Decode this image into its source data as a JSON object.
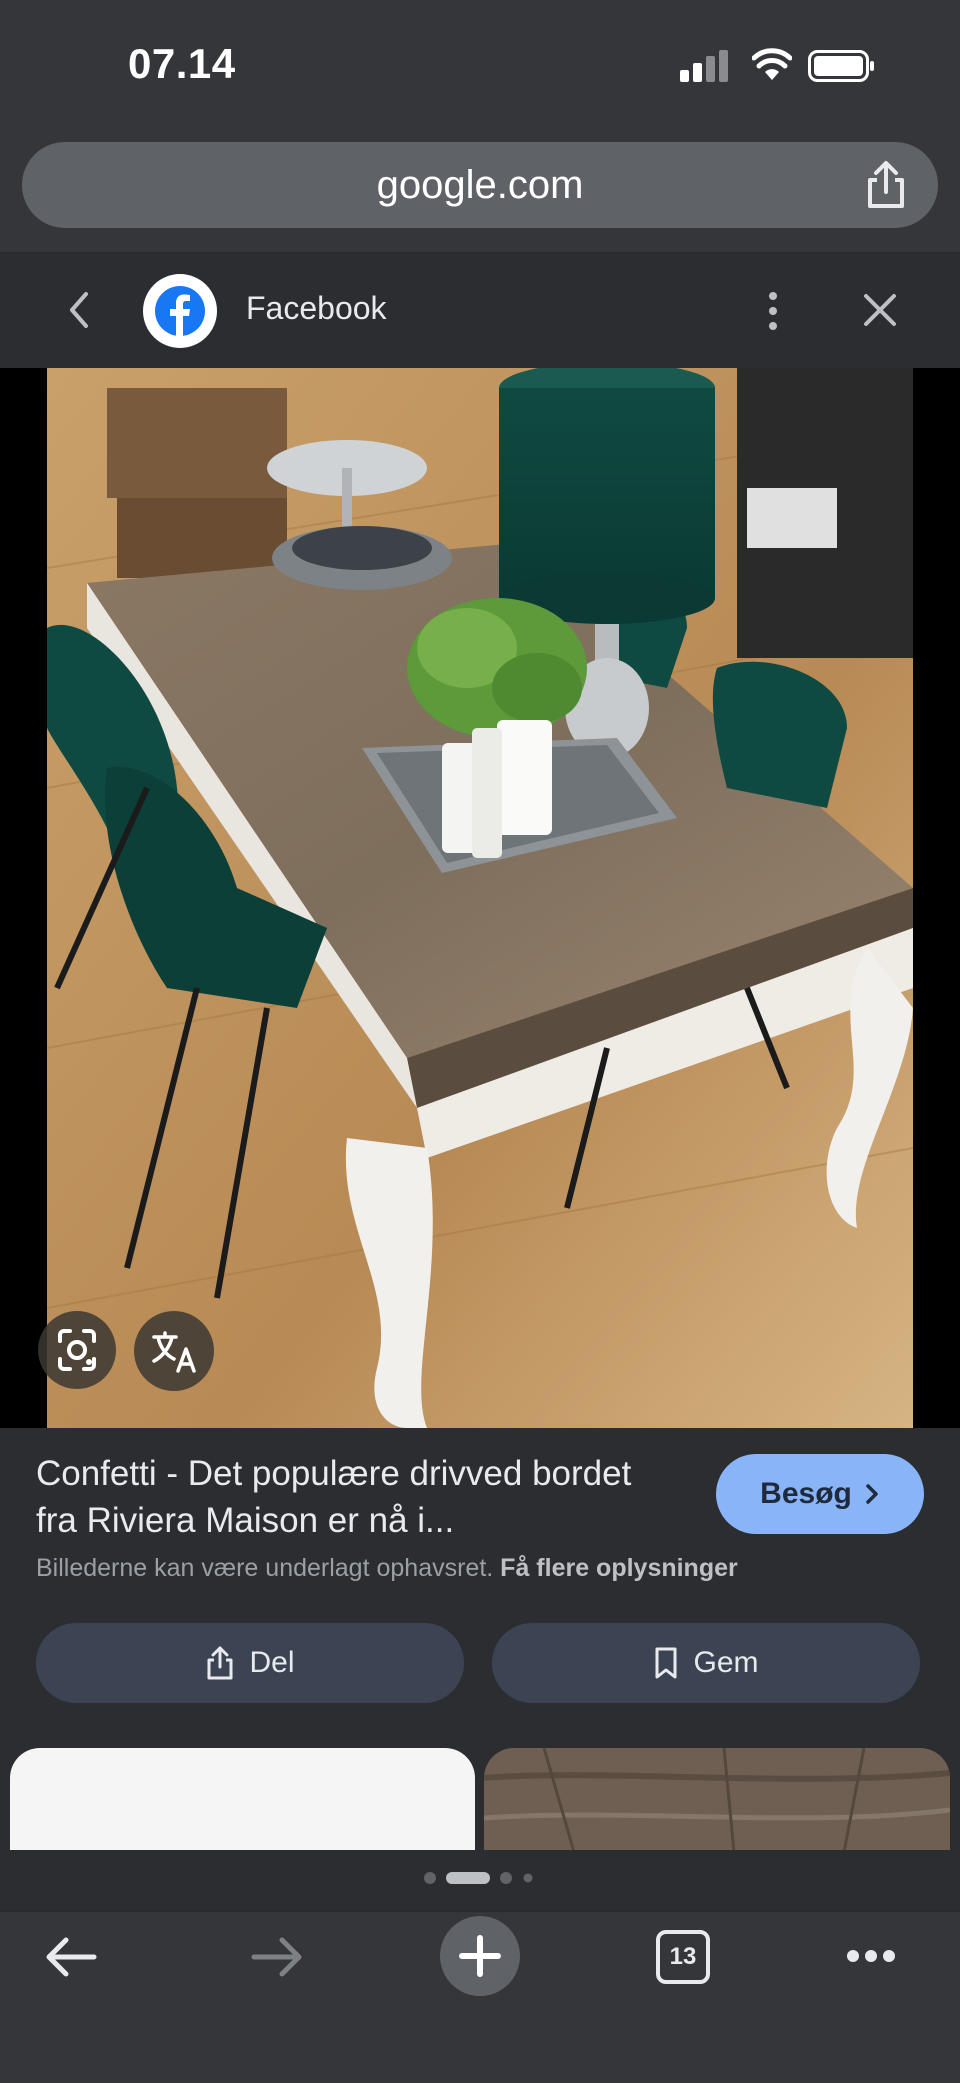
{
  "status": {
    "time": "07.14"
  },
  "browser": {
    "url": "google.com",
    "tab_count": "13"
  },
  "source": {
    "site": "Facebook"
  },
  "result": {
    "title": "Confetti - Det populære drivved bordet fra Riviera Maison er nå i...",
    "visit_label": "Besøg",
    "copyright_text": "Billederne kan være underlagt ophavsret.",
    "more_info_link": "Få flere oplysninger",
    "share_label": "Del",
    "save_label": "Gem"
  },
  "icons": {
    "status": [
      "signal-icon",
      "wifi-icon",
      "battery-icon"
    ],
    "header": [
      "back-chevron-icon",
      "facebook-logo-icon",
      "more-vert-icon",
      "close-icon"
    ],
    "image": [
      "lens-icon",
      "translate-icon"
    ],
    "toolbar": [
      "back-arrow-icon",
      "forward-arrow-icon",
      "new-tab-icon",
      "tabs-icon",
      "more-horiz-icon"
    ]
  },
  "colors": {
    "accent_button": "#8ab4f8",
    "surface": "#2b2d31",
    "toolbar": "#35363a"
  }
}
